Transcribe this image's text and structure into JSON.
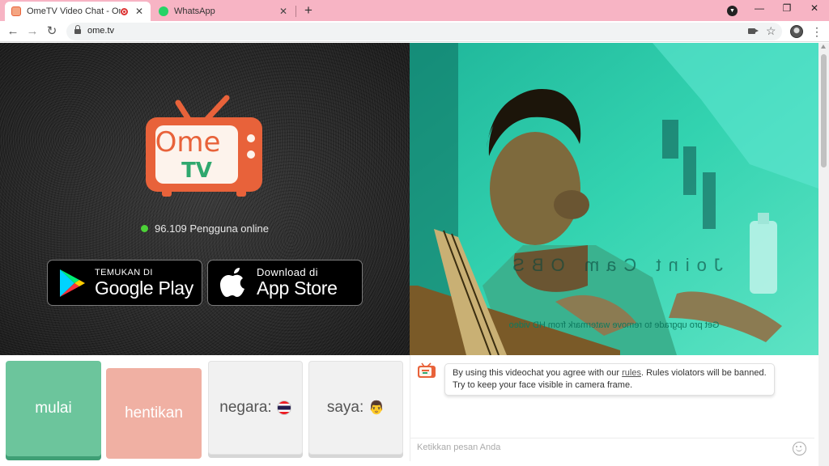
{
  "browser": {
    "tabs": [
      {
        "title": "OmeTV Video Chat - Omegle",
        "favicon": "ometv-favicon",
        "recording": true
      },
      {
        "title": "WhatsApp",
        "favicon": "whatsapp-favicon",
        "recording": false
      }
    ],
    "new_tab_label": "+",
    "url": "ome.tv"
  },
  "logo": {
    "line1": "Ome",
    "line2": "TV",
    "color": "#e8623a"
  },
  "online": {
    "text": "96.109 Pengguna online",
    "dot_color": "#4cd137"
  },
  "stores": {
    "google_play": {
      "small": "TEMUKAN DI",
      "big": "Google Play"
    },
    "app_store": {
      "small": "Download di",
      "big": "App Store"
    }
  },
  "video": {
    "watermark": "Joint Cam OBS",
    "pro_notice": "Get pro upgrade to remove watermark from HD video"
  },
  "controls": {
    "start": "mulai",
    "stop": "hentikan",
    "country": "negara:",
    "country_flag": "thailand-flag",
    "me": "saya:",
    "me_icon": "person-emoji"
  },
  "chat": {
    "message_before": "By using this videochat you agree with our ",
    "rules_link": "rules",
    "message_after": ". Rules violators will be banned. Try to keep your face visible in camera frame.",
    "input_placeholder": "Ketikkan pesan Anda"
  }
}
